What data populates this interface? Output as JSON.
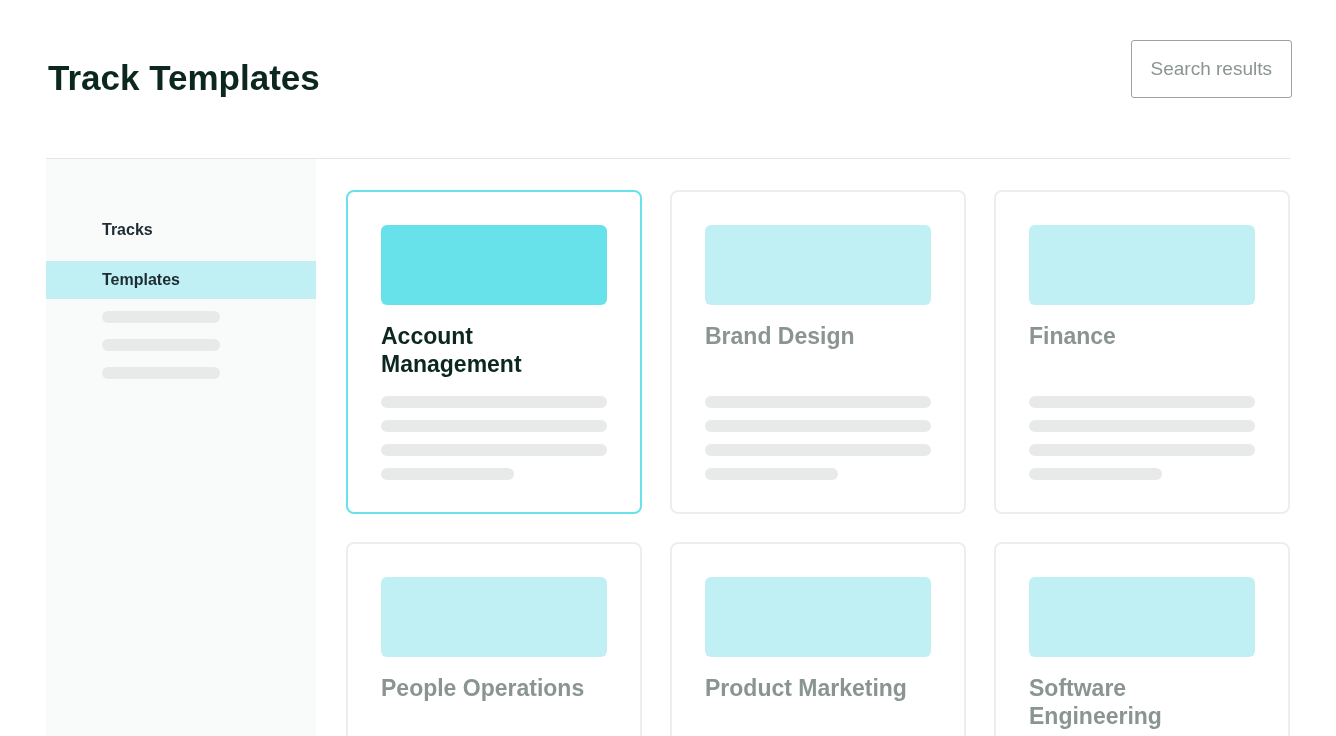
{
  "page": {
    "title": "Track Templates",
    "search_button": "Search results"
  },
  "sidebar": {
    "items": [
      {
        "label": "Tracks",
        "selected": false
      },
      {
        "label": "Templates",
        "selected": true
      }
    ]
  },
  "cards": [
    {
      "title": "Account Management",
      "selected": true
    },
    {
      "title": "Brand Design",
      "selected": false
    },
    {
      "title": "Finance",
      "selected": false
    },
    {
      "title": "People Operations",
      "selected": false
    },
    {
      "title": "Product Marketing",
      "selected": false
    },
    {
      "title": "Software Engineering",
      "selected": false
    }
  ]
}
